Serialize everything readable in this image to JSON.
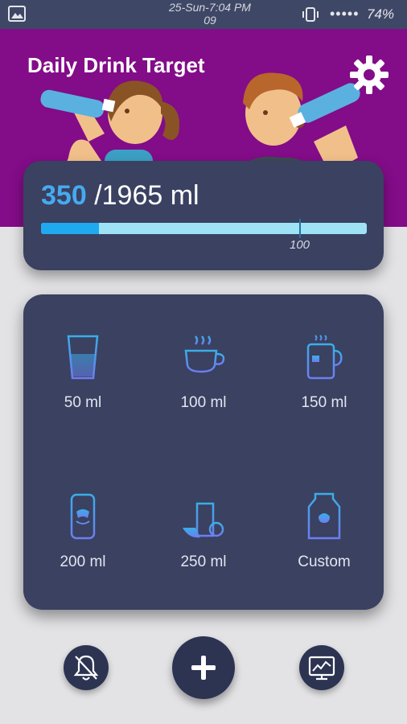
{
  "status_bar": {
    "clock_line1": "25-Sun-7:04 PM",
    "clock_line2": "09",
    "battery": "74%",
    "icons": [
      "gallery-icon",
      "vibrate-icon",
      "signal-dots-icon"
    ]
  },
  "header": {
    "title": "Daily Drink Target",
    "background": "#830c88",
    "icons": [
      "settings-gear-icon"
    ]
  },
  "progress": {
    "current": "350",
    "target_text": "/1965 ml",
    "fraction": 0.178,
    "marker_label": "100",
    "marker_fraction": 0.847,
    "accent": "#46aaf0",
    "track_color": "#9ee3f5"
  },
  "cups": [
    {
      "label": "50 ml",
      "icon": "glass-icon"
    },
    {
      "label": "100 ml",
      "icon": "coffee-cup-icon"
    },
    {
      "label": "150 ml",
      "icon": "tea-mug-icon"
    },
    {
      "label": "200 ml",
      "icon": "can-icon"
    },
    {
      "label": "250 ml",
      "icon": "juice-box-icon"
    },
    {
      "label": "Custom",
      "icon": "milk-carton-icon"
    }
  ],
  "bottom_bar": {
    "icons": [
      "reminder-off-icon",
      "add-icon",
      "statistics-icon"
    ]
  }
}
